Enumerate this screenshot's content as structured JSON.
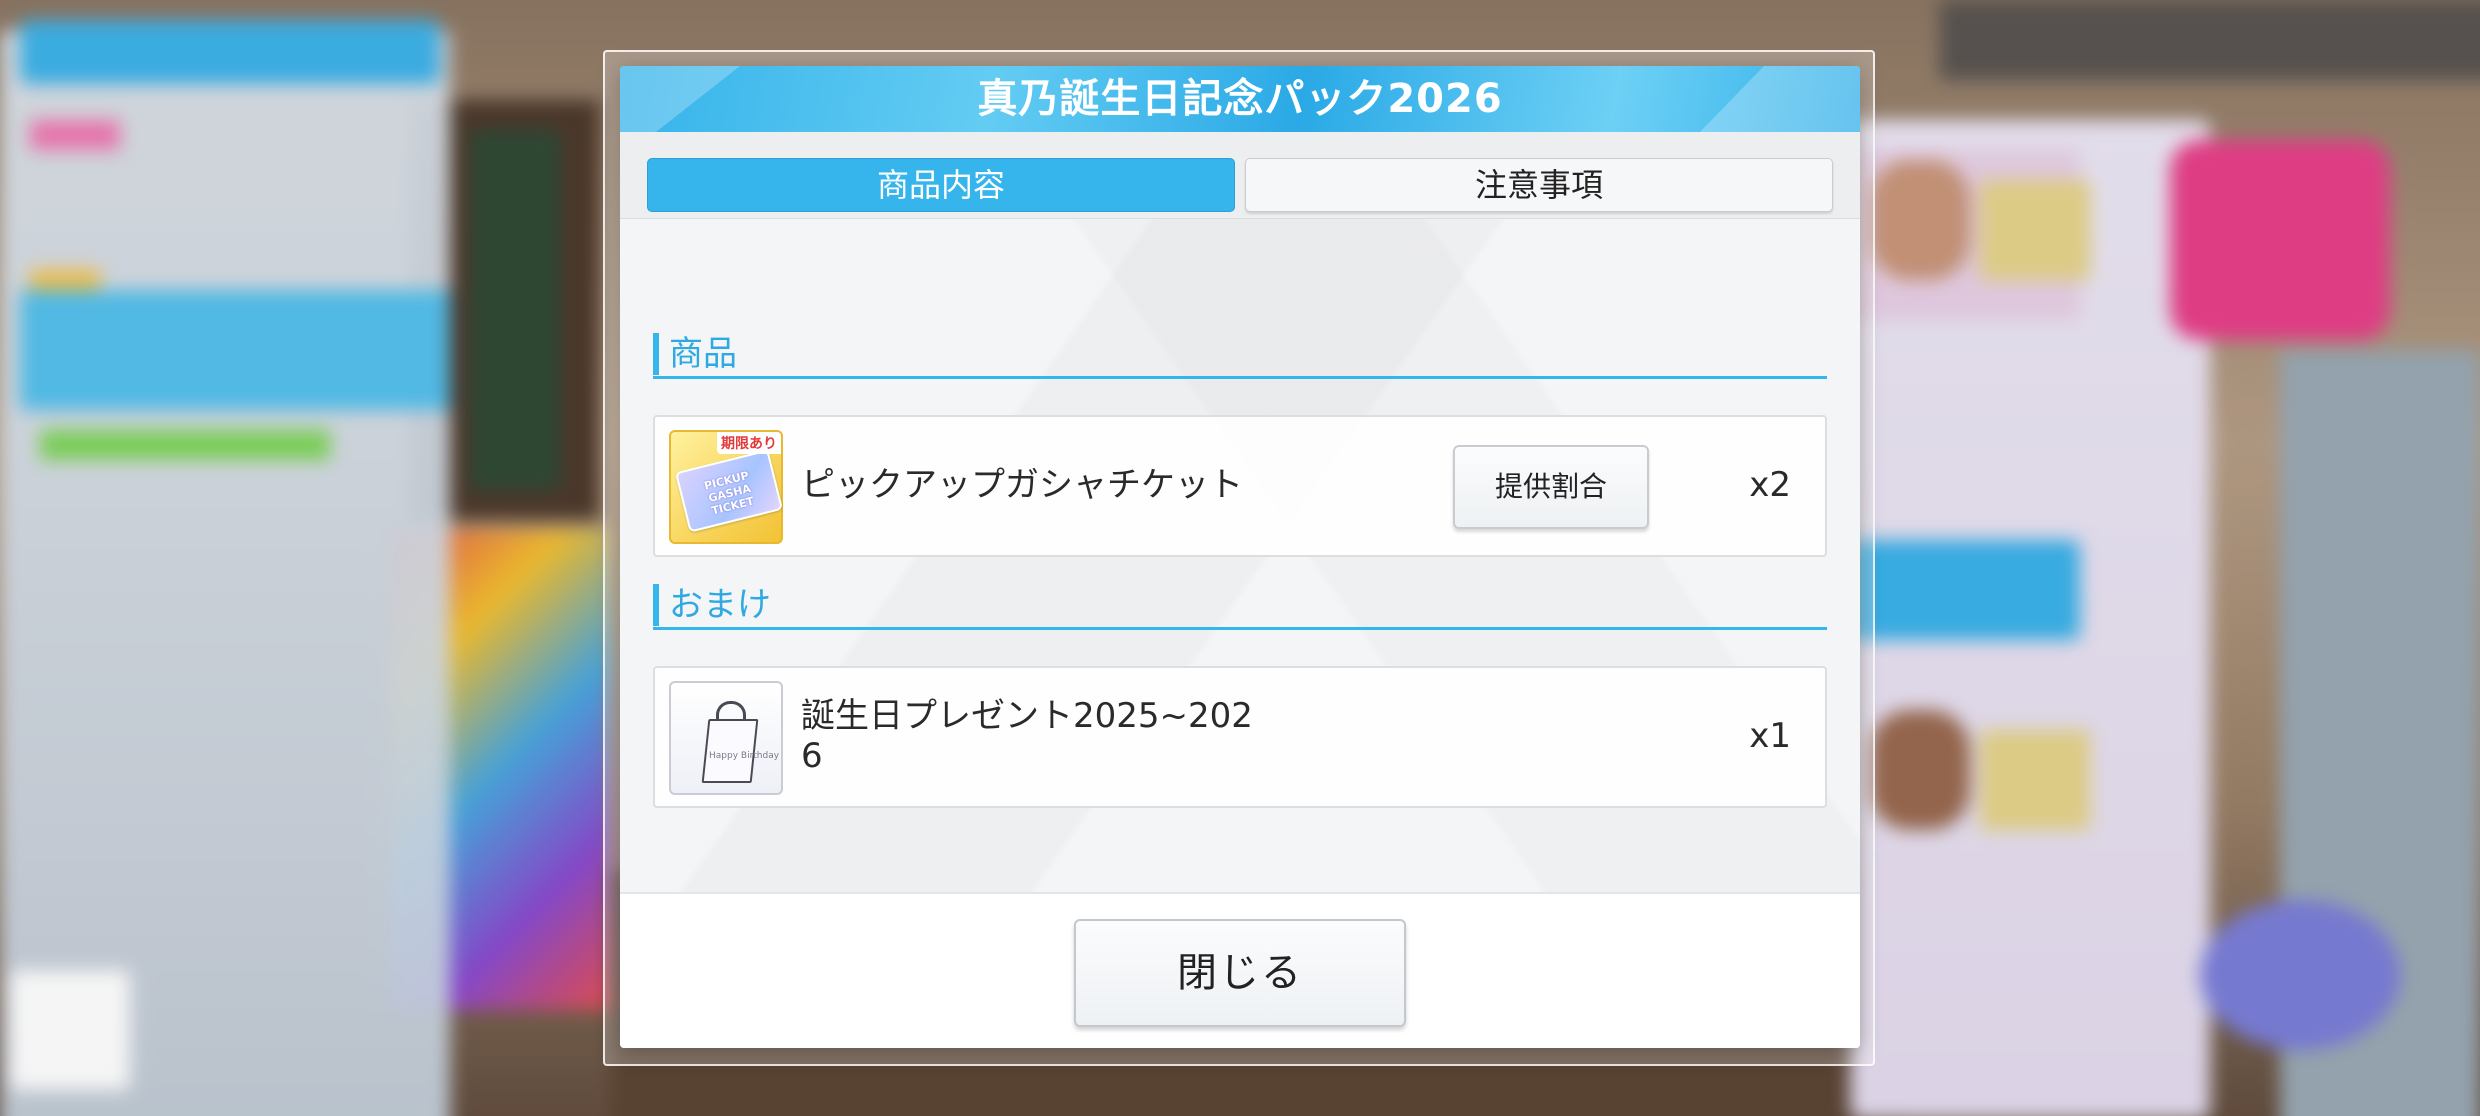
{
  "dialog": {
    "title": "真乃誕生日記念パック2026",
    "tabs": [
      {
        "label": "商品内容",
        "active": true
      },
      {
        "label": "注意事項",
        "active": false
      }
    ],
    "sections": [
      {
        "heading": "商品",
        "items": [
          {
            "name": "ピックアップガシャチケット",
            "quantity": "x2",
            "icon": "pickup-gasha-ticket-icon",
            "icon_badge": "期限あり",
            "icon_text": "PICKUP GASHA TICKET",
            "rate_button": "提供割合"
          }
        ]
      },
      {
        "heading": "おまけ",
        "items": [
          {
            "name_line1": "誕生日プレゼント2025~202",
            "name_line2": "6",
            "quantity": "x1",
            "icon": "present-bag-icon",
            "icon_text": "Happy Birthday"
          }
        ]
      }
    ],
    "close_button": "閉じる"
  },
  "colors": {
    "accent": "#36b5ec",
    "title_bar": "#35b3ea",
    "section_text": "#2fa9e2"
  }
}
